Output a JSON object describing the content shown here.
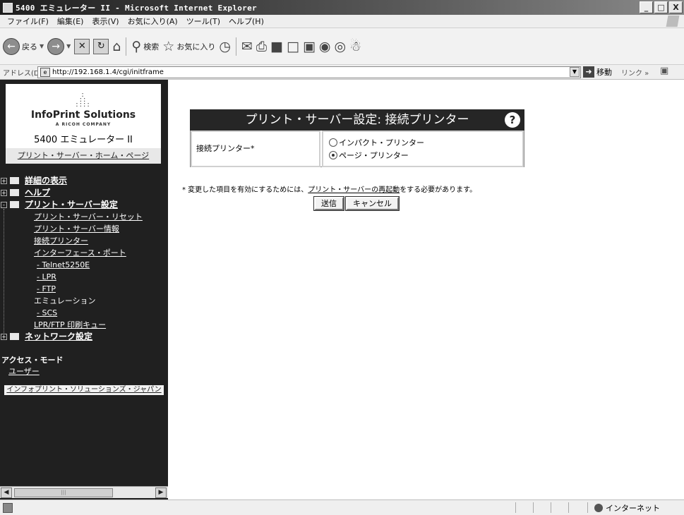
{
  "window": {
    "title": "5400 エミュレーター II - Microsoft Internet Explorer",
    "controls": [
      "_",
      "□",
      "X"
    ]
  },
  "menu": [
    "ファイル(F)",
    "編集(E)",
    "表示(V)",
    "お気に入り(A)",
    "ツール(T)",
    "ヘルプ(H)"
  ],
  "toolbar": {
    "back_label": "戻る",
    "search_label": "検索",
    "favorites_label": "お気に入り"
  },
  "address": {
    "label": "アドレス(D)",
    "url": "http://192.168.1.4/cgi/initframe",
    "go_label": "移動",
    "links_label": "リンク »"
  },
  "sidebar": {
    "logo_name": "InfoPrint Solutions",
    "logo_sub": "A RICOH COMPANY",
    "model": "5400 エミュレーター II",
    "home_link": "プリント・サーバー・ホーム・ページ",
    "tree": [
      {
        "label": "詳細の表示",
        "toggle": "+"
      },
      {
        "label": "ヘルプ",
        "toggle": "+"
      },
      {
        "label": "プリント・サーバー設定",
        "toggle": "-"
      }
    ],
    "subitems": [
      "プリント・サーバー・リセット",
      "プリント・サーバー情報",
      "接続プリンター",
      "インターフェース・ポート",
      "- Telnet5250E",
      "- LPR",
      "- FTP",
      "エミュレーション",
      "- SCS",
      "LPR/FTP 印刷キュー"
    ],
    "network": {
      "label": "ネットワーク設定",
      "toggle": "+"
    },
    "access_heading": "アクセス・モード",
    "access_user": "ユーザー",
    "footer_link": "インフォプリント・ソリューションズ・ジャパン"
  },
  "main": {
    "panel_title": "プリント・サーバー設定: 接続プリンター",
    "field_label": "接続プリンター*",
    "options": [
      {
        "label": "インパクト・プリンター",
        "selected": false
      },
      {
        "label": "ページ・プリンター",
        "selected": true
      }
    ],
    "note_prefix": "* 変更した項目を有効にするためには、",
    "note_link": "プリント・サーバーの再起動",
    "note_suffix": "をする必要があります。",
    "submit_label": "送信",
    "cancel_label": "キャンセル"
  },
  "status": {
    "zone": "インターネット"
  }
}
